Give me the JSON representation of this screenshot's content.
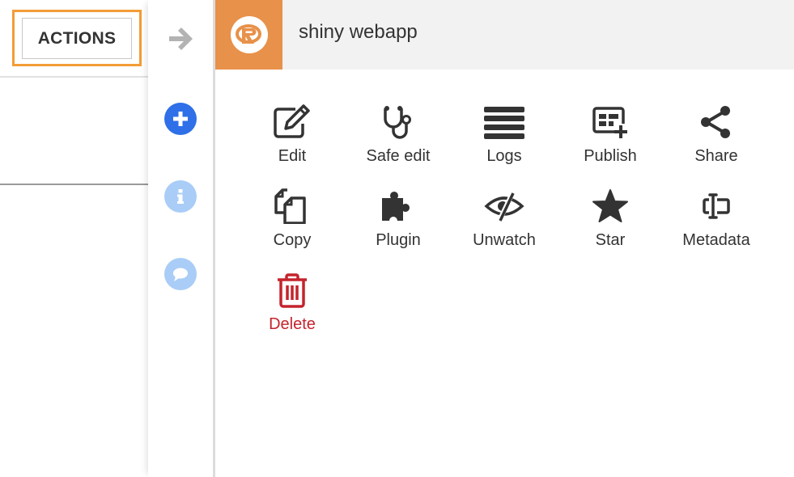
{
  "left": {
    "actions_button_label": "ACTIONS"
  },
  "rail": {
    "items": [
      {
        "name": "arrow-right",
        "color": "#b3b3b3"
      },
      {
        "name": "plus",
        "color": "#2f6fe8"
      },
      {
        "name": "info",
        "color": "#a9cdf7"
      },
      {
        "name": "chat",
        "color": "#a9cdf7"
      }
    ]
  },
  "panel": {
    "title": "shiny webapp",
    "badge_color": "#e8914a",
    "actions": [
      {
        "label": "Edit",
        "icon": "edit-icon"
      },
      {
        "label": "Safe edit",
        "icon": "stethoscope-icon"
      },
      {
        "label": "Logs",
        "icon": "logs-icon"
      },
      {
        "label": "Publish",
        "icon": "publish-icon"
      },
      {
        "label": "Share",
        "icon": "share-icon"
      },
      {
        "label": "Copy",
        "icon": "copy-icon"
      },
      {
        "label": "Plugin",
        "icon": "plugin-icon"
      },
      {
        "label": "Unwatch",
        "icon": "eye-slash-icon"
      },
      {
        "label": "Star",
        "icon": "star-icon"
      },
      {
        "label": "Metadata",
        "icon": "metadata-icon"
      },
      {
        "label": "Delete",
        "icon": "trash-icon",
        "color": "#c4242d"
      }
    ]
  }
}
